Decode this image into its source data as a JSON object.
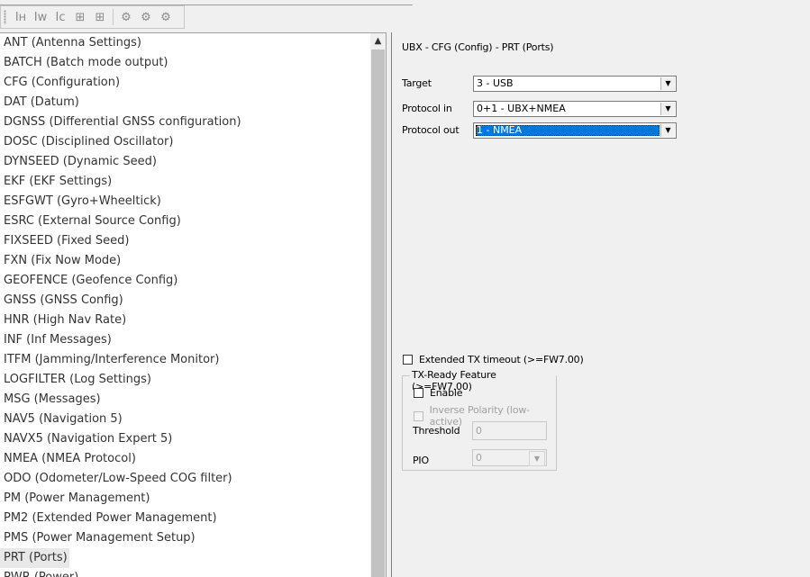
{
  "toolbar": {
    "buttons": [
      {
        "glyph": "Ⅰʜ",
        "name": "h-button"
      },
      {
        "glyph": "Ⅰw",
        "name": "w-button"
      },
      {
        "glyph": "Ⅰc",
        "name": "c-button"
      },
      {
        "glyph": "⊞",
        "name": "grid-button"
      },
      {
        "glyph": "⊞",
        "name": "grid-add-button"
      },
      {
        "glyph": "⚙",
        "name": "gear-button-1"
      },
      {
        "glyph": "⚙",
        "name": "gear-button-2"
      },
      {
        "glyph": "⚙",
        "name": "gear-button-3"
      }
    ]
  },
  "message_list": {
    "items": [
      "ANT (Antenna Settings)",
      "BATCH (Batch mode output)",
      "CFG (Configuration)",
      "DAT (Datum)",
      "DGNSS (Differential GNSS configuration)",
      "DOSC (Disciplined Oscillator)",
      "DYNSEED (Dynamic Seed)",
      "EKF (EKF Settings)",
      "ESFGWT (Gyro+Wheeltick)",
      "ESRC (External Source Config)",
      "FIXSEED (Fixed Seed)",
      "FXN (Fix Now Mode)",
      "GEOFENCE (Geofence Config)",
      "GNSS (GNSS Config)",
      "HNR (High Nav Rate)",
      "INF (Inf Messages)",
      "ITFM (Jamming/Interference Monitor)",
      "LOGFILTER (Log Settings)",
      "MSG (Messages)",
      "NAV5 (Navigation 5)",
      "NAVX5 (Navigation Expert 5)",
      "NMEA (NMEA Protocol)",
      "ODO (Odometer/Low-Speed COG filter)",
      "PM (Power Management)",
      "PM2 (Extended Power Management)",
      "PMS (Power Management Setup)",
      "PRT (Ports)",
      "PWR (Power)"
    ],
    "selected_index": 26
  },
  "panel": {
    "title": "UBX - CFG (Config) - PRT (Ports)",
    "target_label": "Target",
    "target_value": "3 - USB",
    "protocol_in_label": "Protocol in",
    "protocol_in_value": "0+1 - UBX+NMEA",
    "protocol_out_label": "Protocol out",
    "protocol_out_value": "1 - NMEA",
    "ext_tx_label": "Extended TX timeout (>=FW7.00)",
    "txready": {
      "legend": "TX-Ready Feature (>=FW7.00)",
      "enable_label": "Enable",
      "inverse_label": "Inverse Polarity (low-active)",
      "threshold_label": "Threshold",
      "threshold_value": "0",
      "pio_label": "PIO",
      "pio_value": "0"
    }
  }
}
